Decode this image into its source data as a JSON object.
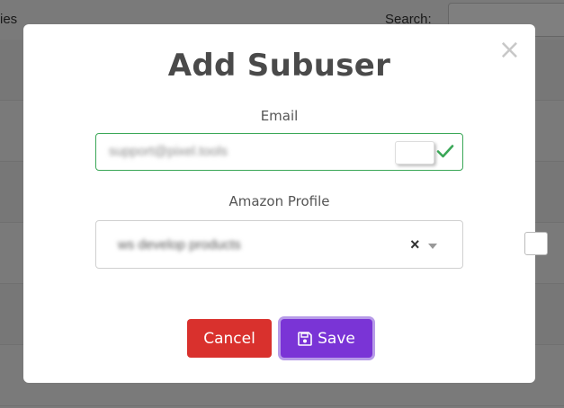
{
  "background": {
    "left_text": "ies",
    "search_label": "Search:"
  },
  "modal": {
    "title": "Add Subuser",
    "close_glyph": "×",
    "email": {
      "label": "Email",
      "value": "support@pixel.tools",
      "valid_icon": "check-icon",
      "valid_color": "#3aa757"
    },
    "amazon_profile": {
      "label": "Amazon Profile",
      "selected": "ws develop products",
      "clear_glyph": "×"
    },
    "buttons": {
      "cancel": "Cancel",
      "save": "Save"
    }
  },
  "colors": {
    "cancel": "#d9312d",
    "save": "#7a34d6",
    "overlay": "rgba(0,0,0,0.5)"
  }
}
